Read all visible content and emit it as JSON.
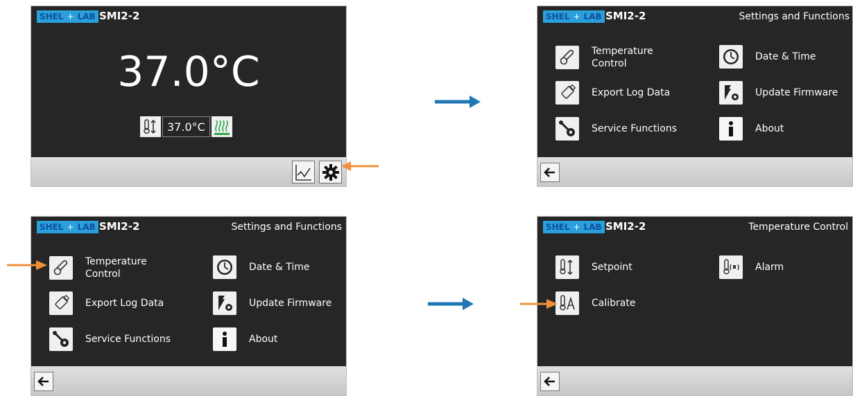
{
  "brand": {
    "left": "SHEL",
    "middle": "+",
    "right": "LAB"
  },
  "model": "SMI2-2",
  "panel1": {
    "temperature": "37.0°C",
    "setpoint": "37.0°C",
    "icons": {
      "setpoint": "thermometer-updown-icon",
      "heater": "heater-icon",
      "graph": "graph-icon",
      "settings": "gear-icon"
    }
  },
  "settings_menu": {
    "title": "Settings and Functions",
    "items": [
      {
        "label_line1": "Temperature",
        "label_line2": "Control",
        "icon": "thermometer-icon"
      },
      {
        "label_line1": "Date & Time",
        "label_line2": "",
        "icon": "clock-icon"
      },
      {
        "label_line1": "Export Log Data",
        "label_line2": "",
        "icon": "usb-drive-icon"
      },
      {
        "label_line1": "Update Firmware",
        "label_line2": "",
        "icon": "firmware-icon"
      },
      {
        "label_line1": "Service Functions",
        "label_line2": "",
        "icon": "wrench-gear-icon"
      },
      {
        "label_line1": "About",
        "label_line2": "",
        "icon": "info-icon"
      }
    ]
  },
  "temperature_control": {
    "title": "Temperature Control",
    "items": [
      {
        "label": "Setpoint",
        "icon": "thermometer-updown-icon"
      },
      {
        "label": "Alarm",
        "icon": "thermometer-alarm-icon"
      },
      {
        "label": "Calibrate",
        "icon": "thermometer-calibrate-icon"
      }
    ]
  },
  "colors": {
    "flow_arrow": "#1f77b4",
    "pointer_arrow": "#f0913a",
    "screen_bg": "#262626",
    "footer": "#d2d2d2"
  }
}
